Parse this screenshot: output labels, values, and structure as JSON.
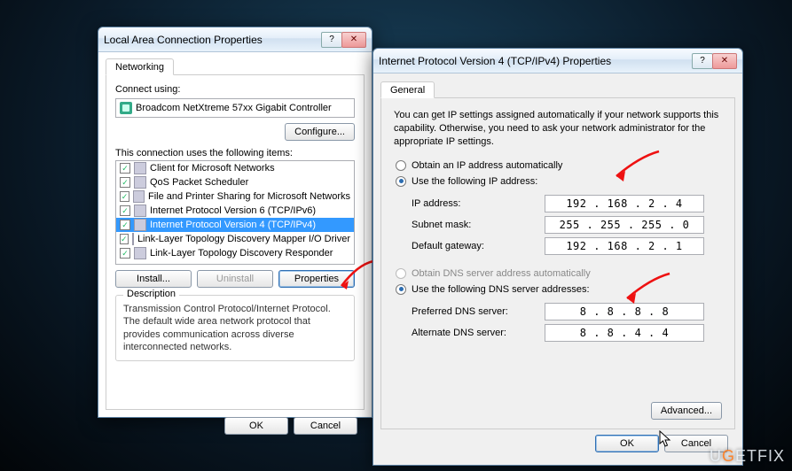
{
  "watermark_prefix": "U",
  "watermark_mid": "G",
  "watermark_suffix": "ETFIX",
  "win1": {
    "title": "Local Area Connection Properties",
    "tab": "Networking",
    "connect_using_label": "Connect using:",
    "adapter": "Broadcom NetXtreme 57xx Gigabit Controller",
    "configure": "Configure...",
    "items_label": "This connection uses the following items:",
    "items": [
      {
        "label": "Client for Microsoft Networks"
      },
      {
        "label": "QoS Packet Scheduler"
      },
      {
        "label": "File and Printer Sharing for Microsoft Networks"
      },
      {
        "label": "Internet Protocol Version 6 (TCP/IPv6)"
      },
      {
        "label": "Internet Protocol Version 4 (TCP/IPv4)"
      },
      {
        "label": "Link-Layer Topology Discovery Mapper I/O Driver"
      },
      {
        "label": "Link-Layer Topology Discovery Responder"
      }
    ],
    "install": "Install...",
    "uninstall": "Uninstall",
    "properties": "Properties",
    "desc_heading": "Description",
    "desc": "Transmission Control Protocol/Internet Protocol. The default wide area network protocol that provides communication across diverse interconnected networks.",
    "ok": "OK",
    "cancel": "Cancel"
  },
  "win2": {
    "title": "Internet Protocol Version 4 (TCP/IPv4) Properties",
    "tab": "General",
    "desc": "You can get IP settings assigned automatically if your network supports this capability. Otherwise, you need to ask your network administrator for the appropriate IP settings.",
    "ip_auto": "Obtain an IP address automatically",
    "ip_manual": "Use the following IP address:",
    "ip_address_label": "IP address:",
    "ip_address": "192 . 168 .  2  .  4",
    "subnet_label": "Subnet mask:",
    "subnet": "255 . 255 . 255 .  0",
    "gateway_label": "Default gateway:",
    "gateway": "192 . 168 .  2  .  1",
    "dns_auto": "Obtain DNS server address automatically",
    "dns_manual": "Use the following DNS server addresses:",
    "pref_dns_label": "Preferred DNS server:",
    "pref_dns": "8  .  8  .  8  .  8",
    "alt_dns_label": "Alternate DNS server:",
    "alt_dns": "8  .  8  .  4  .  4",
    "advanced": "Advanced...",
    "ok": "OK",
    "cancel": "Cancel"
  }
}
